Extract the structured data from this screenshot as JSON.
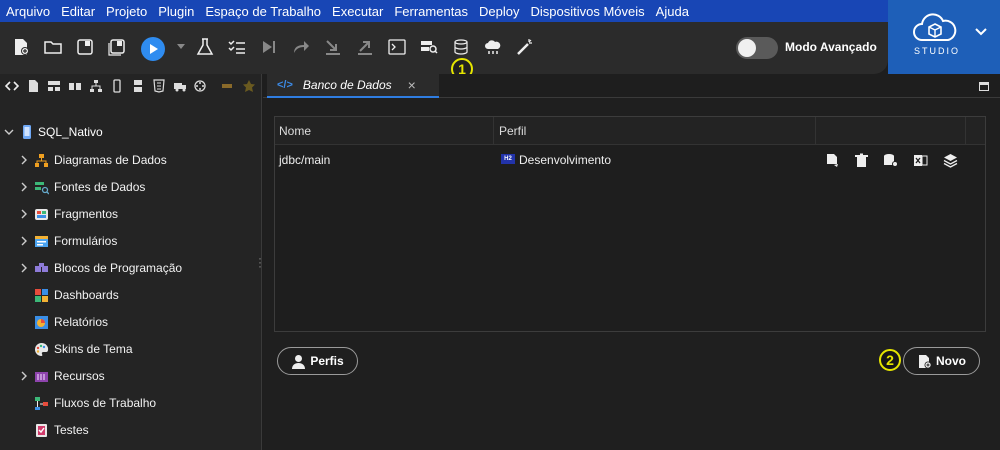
{
  "menu": [
    "Arquivo",
    "Editar",
    "Projeto",
    "Plugin",
    "Espaço de Trabalho",
    "Executar",
    "Ferramentas",
    "Deploy",
    "Dispositivos Móveis",
    "Ajuda"
  ],
  "toolbar": {
    "advanced_mode_label": "Modo Avançado",
    "advanced_mode_on": false,
    "callout_1": "1",
    "callout_2": "2"
  },
  "brand": {
    "label": "STUDIO"
  },
  "tree": {
    "root": "SQL_Nativo",
    "items": [
      {
        "label": "Diagramas de Dados",
        "expandable": true,
        "icon": "diagram-icon"
      },
      {
        "label": "Fontes de Dados",
        "expandable": true,
        "icon": "datasource-icon"
      },
      {
        "label": "Fragmentos",
        "expandable": true,
        "icon": "fragment-icon"
      },
      {
        "label": "Formulários",
        "expandable": true,
        "icon": "form-icon"
      },
      {
        "label": "Blocos de Programação",
        "expandable": true,
        "icon": "blocks-icon"
      },
      {
        "label": "Dashboards",
        "expandable": false,
        "icon": "dashboard-icon"
      },
      {
        "label": "Relatórios",
        "expandable": false,
        "icon": "report-icon"
      },
      {
        "label": "Skins de Tema",
        "expandable": false,
        "icon": "palette-icon"
      },
      {
        "label": "Recursos",
        "expandable": true,
        "icon": "resources-icon"
      },
      {
        "label": "Fluxos de Trabalho",
        "expandable": false,
        "icon": "workflow-icon"
      },
      {
        "label": "Testes",
        "expandable": false,
        "icon": "tests-icon"
      }
    ]
  },
  "tab": {
    "title": "Banco de Dados",
    "code_icon": "</>",
    "close": "×"
  },
  "table": {
    "columns": [
      "Nome",
      "Perfil"
    ],
    "rows": [
      {
        "name": "jdbc/main",
        "profile_badge": "H2",
        "profile": "Desenvolvimento"
      }
    ]
  },
  "buttons": {
    "profiles": "Perfis",
    "new": "Novo"
  }
}
